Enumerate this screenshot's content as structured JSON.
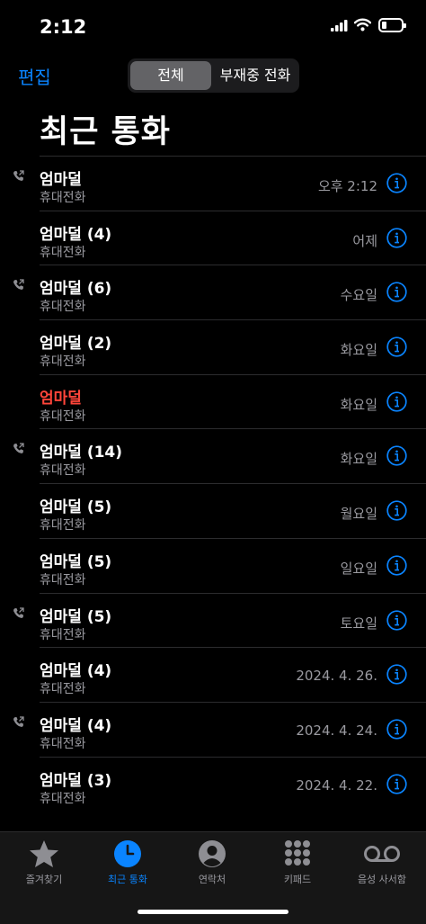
{
  "status": {
    "time": "2:12"
  },
  "header": {
    "edit": "편집",
    "segments": {
      "all": "전체",
      "missed": "부재중 전화"
    },
    "title": "최근 통화"
  },
  "calls": [
    {
      "name": "엄마덜",
      "type": "휴대전화",
      "when": "오후 2:12",
      "outgoing": true,
      "missed": false
    },
    {
      "name": "엄마덜 (4)",
      "type": "휴대전화",
      "when": "어제",
      "outgoing": false,
      "missed": false
    },
    {
      "name": "엄마덜 (6)",
      "type": "휴대전화",
      "when": "수요일",
      "outgoing": true,
      "missed": false
    },
    {
      "name": "엄마덜 (2)",
      "type": "휴대전화",
      "when": "화요일",
      "outgoing": false,
      "missed": false
    },
    {
      "name": "엄마덜",
      "type": "휴대전화",
      "when": "화요일",
      "outgoing": false,
      "missed": true
    },
    {
      "name": "엄마덜 (14)",
      "type": "휴대전화",
      "when": "화요일",
      "outgoing": true,
      "missed": false
    },
    {
      "name": "엄마덜 (5)",
      "type": "휴대전화",
      "when": "월요일",
      "outgoing": false,
      "missed": false
    },
    {
      "name": "엄마덜 (5)",
      "type": "휴대전화",
      "when": "일요일",
      "outgoing": false,
      "missed": false
    },
    {
      "name": "엄마덜 (5)",
      "type": "휴대전화",
      "when": "토요일",
      "outgoing": true,
      "missed": false
    },
    {
      "name": "엄마덜 (4)",
      "type": "휴대전화",
      "when": "2024. 4. 26.",
      "outgoing": false,
      "missed": false
    },
    {
      "name": "엄마덜 (4)",
      "type": "휴대전화",
      "when": "2024. 4. 24.",
      "outgoing": true,
      "missed": false
    },
    {
      "name": "엄마덜 (3)",
      "type": "휴대전화",
      "when": "2024. 4. 22.",
      "outgoing": false,
      "missed": false
    }
  ],
  "tabs": [
    {
      "label": "즐겨찾기",
      "icon": "star-icon",
      "active": false
    },
    {
      "label": "최근 통화",
      "icon": "clock-icon",
      "active": true
    },
    {
      "label": "연락처",
      "icon": "person-circle-icon",
      "active": false
    },
    {
      "label": "키패드",
      "icon": "keypad-icon",
      "active": false
    },
    {
      "label": "음성 사서함",
      "icon": "voicemail-icon",
      "active": false
    }
  ],
  "colors": {
    "accent": "#0a84ff",
    "missed": "#ff453a",
    "secondary_text": "#9a9aa0"
  }
}
